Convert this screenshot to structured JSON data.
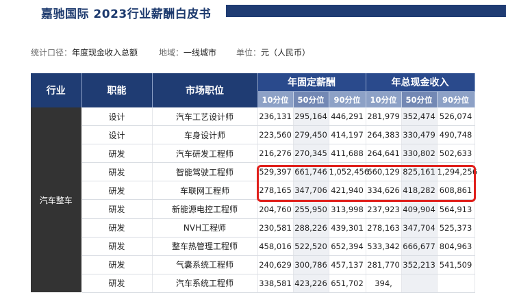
{
  "header": {
    "title": "嘉驰国际 2023行业薪酬白皮书",
    "bar_color": "#1f3c73"
  },
  "meta": {
    "stat_label": "统计口径：",
    "stat_value": "年度现金收入总额",
    "region_label": "地域：",
    "region_value": "一线城市",
    "unit_label": "单位：",
    "unit_value": "元（人民币）"
  },
  "table": {
    "headers": {
      "industry": "行业",
      "function": "职能",
      "position": "市场职位",
      "fixed_group": "年固定薪酬",
      "total_group": "年总现金收入",
      "percentiles": [
        "10分位",
        "50分位",
        "90分位",
        "10分位",
        "50分位",
        "90分位"
      ]
    },
    "industry": "汽车整车",
    "rows": [
      {
        "function": "设计",
        "position": "汽车工艺设计师",
        "values": [
          "236,131",
          "295,164",
          "446,291",
          "281,979",
          "352,474",
          "526,074"
        ]
      },
      {
        "function": "设计",
        "position": "车身设计师",
        "values": [
          "223,560",
          "279,450",
          "414,197",
          "264,383",
          "330,479",
          "490,748"
        ]
      },
      {
        "function": "研发",
        "position": "汽车研发工程师",
        "values": [
          "216,276",
          "270,345",
          "411,688",
          "264,641",
          "330,802",
          "502,633"
        ]
      },
      {
        "function": "研发",
        "position": "智能驾驶工程师",
        "values": [
          "529,397",
          "661,746",
          "1,052,456",
          "660,129",
          "825,161",
          "1,294,256"
        ]
      },
      {
        "function": "研发",
        "position": "车联网工程师",
        "values": [
          "278,165",
          "347,706",
          "421,940",
          "334,626",
          "418,282",
          "608,861"
        ]
      },
      {
        "function": "研发",
        "position": "新能源电控工程师",
        "values": [
          "204,760",
          "255,950",
          "313,998",
          "237,923",
          "409,904",
          "564,913"
        ]
      },
      {
        "function": "研发",
        "position": "NVH工程师",
        "values": [
          "230,581",
          "288,226",
          "439,301",
          "278,163",
          "347,704",
          "525,373"
        ]
      },
      {
        "function": "研发",
        "position": "整车热管理工程师",
        "values": [
          "458,016",
          "522,520",
          "652,394",
          "533,342",
          "666,677",
          "804,963"
        ]
      },
      {
        "function": "研发",
        "position": "气囊系统工程师",
        "values": [
          "240,629",
          "300,786",
          "457,137",
          "281,770",
          "352,213",
          "541,509"
        ]
      },
      {
        "function": "研发",
        "position": "汽车系统工程师",
        "values": [
          "338,581",
          "423,226",
          "651,702",
          "394,",
          "",
          ""
        ]
      }
    ],
    "highlight_color": "#e0201c"
  }
}
